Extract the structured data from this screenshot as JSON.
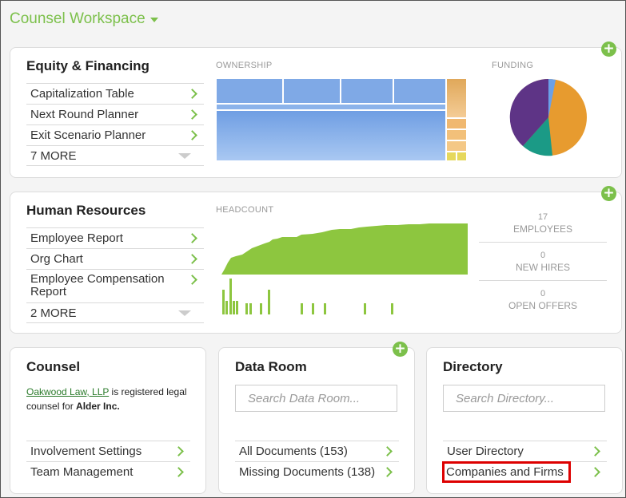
{
  "workspace": {
    "title": "Counsel Workspace"
  },
  "colors": {
    "accent": "#7cc04b",
    "highlight": "#dd0000"
  },
  "equity": {
    "title": "Equity & Financing",
    "links": [
      "Capitalization Table",
      "Next Round Planner",
      "Exit Scenario Planner"
    ],
    "more": "7 MORE",
    "ownership_label": "OWNERSHIP",
    "funding_label": "FUNDING"
  },
  "hr": {
    "title": "Human Resources",
    "links": [
      "Employee Report",
      "Org Chart",
      "Employee Compensation Report"
    ],
    "more": "2 MORE",
    "headcount_label": "HEADCOUNT",
    "stats": [
      {
        "value": "17",
        "label": "EMPLOYEES"
      },
      {
        "value": "0",
        "label": "NEW HIRES"
      },
      {
        "value": "0",
        "label": "OPEN OFFERS"
      }
    ]
  },
  "counsel": {
    "title": "Counsel",
    "firm": "Oakwood Law, LLP",
    "text_mid": " is registered legal counsel for ",
    "company": "Alder Inc.",
    "links": [
      "Involvement Settings",
      "Team Management"
    ]
  },
  "dataroom": {
    "title": "Data Room",
    "search_placeholder": "Search Data Room...",
    "links": [
      "All Documents (153)",
      "Missing Documents (138)"
    ]
  },
  "directory": {
    "title": "Directory",
    "search_placeholder": "Search Directory...",
    "links": [
      "User Directory",
      "Companies and Firms"
    ]
  },
  "icons": {
    "add": "plus-circle-icon",
    "chevron": "chevron-right-icon",
    "search": "search-icon",
    "caret": "caret-down-icon"
  }
}
